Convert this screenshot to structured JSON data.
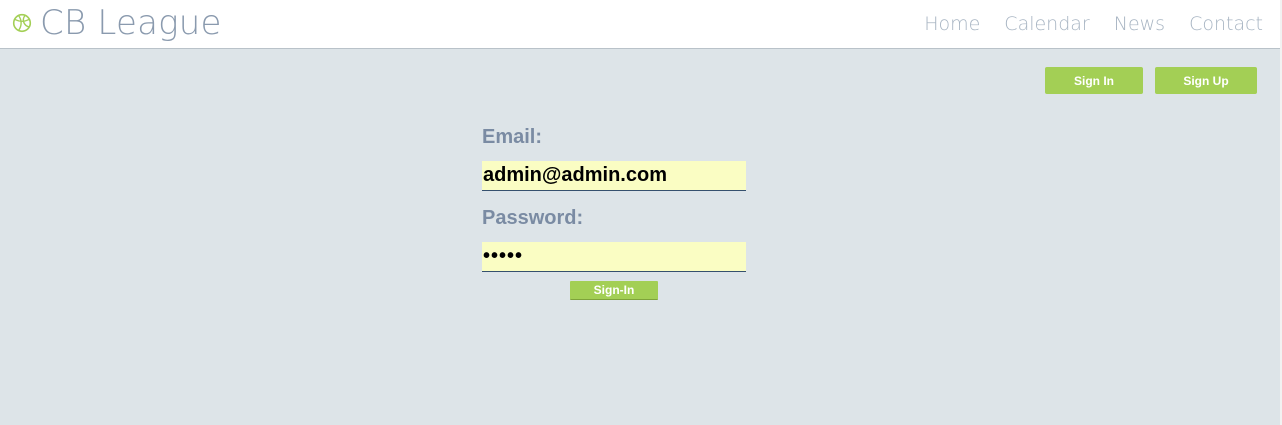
{
  "header": {
    "brand": "CB League",
    "brand_icon": "basketball-icon",
    "accent_color": "#a3cf55",
    "nav": [
      {
        "label": "Home"
      },
      {
        "label": "Calendar"
      },
      {
        "label": "News"
      },
      {
        "label": "Contact"
      }
    ]
  },
  "auth_buttons": {
    "sign_in": "Sign In",
    "sign_up": "Sign Up"
  },
  "login_form": {
    "email_label": "Email:",
    "email_value": "admin@admin.com",
    "password_label": "Password:",
    "password_value": "•••••",
    "submit_label": "Sign-In"
  }
}
